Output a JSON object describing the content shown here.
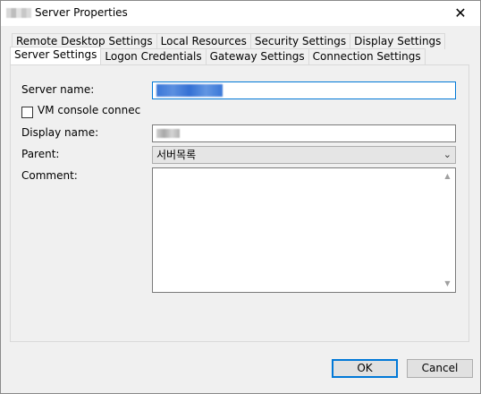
{
  "window": {
    "title": "Server Properties",
    "close_glyph": "✕"
  },
  "tabs": {
    "back_row": [
      {
        "label": "Remote Desktop Settings"
      },
      {
        "label": "Local Resources"
      },
      {
        "label": "Security Settings"
      },
      {
        "label": "Display Settings"
      }
    ],
    "front_row": [
      {
        "label": "Server Settings",
        "active": true
      },
      {
        "label": "Logon Credentials"
      },
      {
        "label": "Gateway Settings"
      },
      {
        "label": "Connection Settings"
      }
    ]
  },
  "form": {
    "server_name_label": "Server name:",
    "vm_console_label": "VM console connec",
    "vm_console_checked": false,
    "display_name_label": "Display name:",
    "parent_label": "Parent:",
    "parent_value": "서버목록",
    "comment_label": "Comment:"
  },
  "buttons": {
    "ok": "OK",
    "cancel": "Cancel"
  },
  "icons": {
    "close": "close-icon",
    "dropdown": "chevron-down-icon",
    "scroll_up": "scroll-up-icon",
    "scroll_down": "scroll-down-icon"
  },
  "colors": {
    "focus": "#0078d7",
    "background": "#f0f0f0"
  }
}
